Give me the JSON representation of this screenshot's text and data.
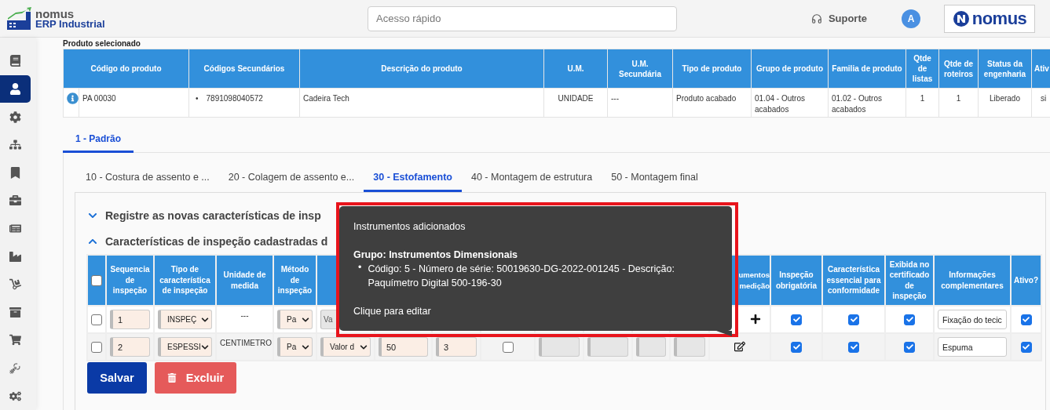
{
  "header": {
    "logo": {
      "brand": "nomus",
      "product": "ERP Industrial"
    },
    "search": {
      "placeholder": "Acesso rápido"
    },
    "support": "Suporte",
    "avatar": "A",
    "brand_logo": "nomus"
  },
  "sidebar": {
    "items": [
      {
        "kind": "book",
        "selected": false
      },
      {
        "kind": "user",
        "selected": true
      },
      {
        "kind": "settings",
        "selected": false
      },
      {
        "kind": "hierarchy",
        "selected": false
      },
      {
        "kind": "bookmark",
        "selected": false
      },
      {
        "kind": "briefcase",
        "selected": false
      },
      {
        "kind": "document",
        "selected": false
      },
      {
        "kind": "factory",
        "selected": false
      },
      {
        "kind": "dolly",
        "selected": false
      },
      {
        "kind": "archive",
        "selected": false
      },
      {
        "kind": "cart",
        "selected": false
      },
      {
        "kind": "robot",
        "selected": false
      },
      {
        "kind": "cogs",
        "selected": false
      }
    ]
  },
  "product": {
    "title": "Produto selecionado",
    "columns": [
      "Código do produto",
      "Códigos Secundários",
      "Descrição do produto",
      "U.M.",
      "U.M. Secundária",
      "Tipo de produto",
      "Grupo de produto",
      "Familia de produto",
      "Qtde de listas",
      "Qtde de roteiros",
      "Status da engenharia",
      "Ativ"
    ],
    "row": {
      "code": "PA 00030",
      "secondary_codes": [
        {
          "marker": "•",
          "text": "7891098040572"
        }
      ],
      "cells": [
        "Cadeira Tech",
        "UNIDADE",
        "---",
        "Produto acabado",
        "01.04 - Outros acabados",
        "01.02 - Outros acabados",
        "1",
        "1",
        "Liberado",
        "si"
      ]
    }
  },
  "structure_tabs": [
    {
      "label": "1 - Padrão",
      "selected": true
    }
  ],
  "operation_tabs": [
    {
      "label": "10 - Costura de assento e ...",
      "selected": false
    },
    {
      "label": "20 - Colagem de assento e...",
      "selected": false
    },
    {
      "label": "30 - Estofamento",
      "selected": true
    },
    {
      "label": "40 - Montagem de estrutura",
      "selected": false
    },
    {
      "label": "50 - Montagem final",
      "selected": false
    }
  ],
  "sections": [
    {
      "title": "Registre as novas características de insp",
      "expanded": false
    },
    {
      "title": "Características de inspeção cadastradas d",
      "expanded": true
    }
  ],
  "inspection_table": {
    "select_all": {
      "checked": false
    },
    "columns": [
      null,
      "Sequencia de inspeção",
      "Tipo de característica de inspeção",
      "Unidade de medida",
      "Método de inspeção",
      null,
      null,
      null,
      null,
      null,
      null,
      null,
      null,
      "umentos\nmedição",
      "Inspeção obrigatória",
      "Característica essencial para conformidade",
      "Exibida no certificado de inspeção",
      "Informações complementares",
      "Ativo?"
    ],
    "rows": [
      {
        "cells": [
          {
            "kind": "check",
            "checked": false
          },
          {
            "kind": "input",
            "value": "1"
          },
          {
            "kind": "select",
            "value": "INSPEÇ",
            "disabled": false
          },
          {
            "kind": "text",
            "value": "---"
          },
          {
            "kind": "select",
            "value": "Pa",
            "disabled": false
          },
          {
            "kind": "select",
            "value": "Va",
            "disabled": true
          },
          null,
          null,
          null,
          null,
          null,
          null,
          null,
          {
            "kind": "add"
          },
          {
            "kind": "check",
            "checked": true
          },
          {
            "kind": "check",
            "checked": true
          },
          {
            "kind": "check",
            "checked": true
          },
          {
            "kind": "input",
            "value": "Fixação do tecic"
          },
          {
            "kind": "check",
            "checked": true
          }
        ]
      },
      {
        "cells": [
          {
            "kind": "check",
            "checked": false
          },
          {
            "kind": "input",
            "value": "2"
          },
          {
            "kind": "select",
            "value": "ESPESSI",
            "disabled": false
          },
          {
            "kind": "text",
            "value": "CENTIMETRO"
          },
          {
            "kind": "select",
            "value": "Pa",
            "disabled": false
          },
          {
            "kind": "select",
            "value": "Valor d",
            "disabled": false
          },
          {
            "kind": "input",
            "value": "50"
          },
          {
            "kind": "input",
            "value": "3"
          },
          {
            "kind": "check",
            "checked": false
          },
          {
            "kind": "input",
            "disabled": true
          },
          {
            "kind": "input",
            "disabled": true
          },
          {
            "kind": "input",
            "disabled": true
          },
          {
            "kind": "input",
            "disabled": true
          },
          {
            "kind": "edit"
          },
          {
            "kind": "check",
            "checked": true
          },
          {
            "kind": "check",
            "checked": true
          },
          {
            "kind": "check",
            "checked": true
          },
          {
            "kind": "input",
            "value": "Espuma"
          },
          {
            "kind": "check",
            "checked": true
          }
        ]
      }
    ]
  },
  "buttons": {
    "save": "Salvar",
    "delete": "Excluir"
  },
  "tooltip": {
    "title": "Instrumentos adicionados",
    "group": "Grupo: Instrumentos Dimensionais",
    "items": [
      {
        "marker": "•",
        "text": "Código: 5 - Número de série: 50019630-DG-2022-001245 - Descrição: Paquímetro Digital 500-196-30"
      }
    ],
    "hint": "Clique para editar"
  }
}
